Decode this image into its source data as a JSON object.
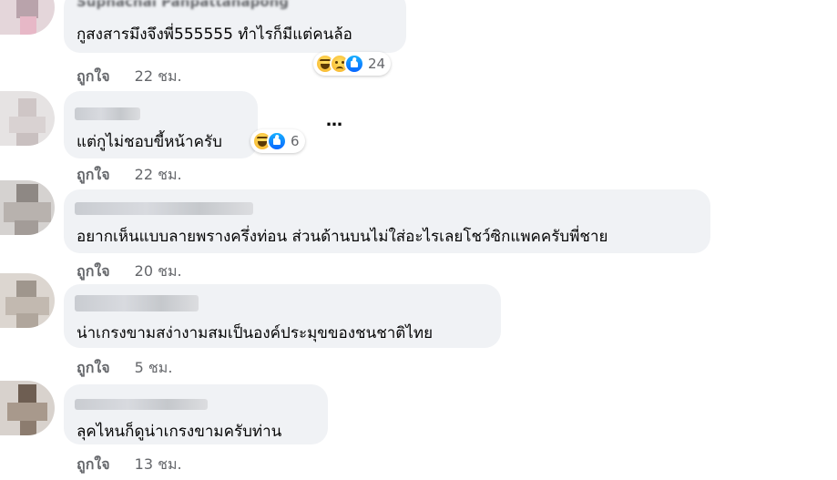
{
  "comments": [
    {
      "author": "Suphachai Panpattanapong",
      "text": "กูสงสารมึงจึงพี่555555 ทำไรก็มีแต่คนล้อ",
      "like_label": "ถูกใจ",
      "time": "22 ชม.",
      "reactions": [
        "haha-icon",
        "sad-icon",
        "like-icon"
      ],
      "reaction_count": "24"
    },
    {
      "text": "แต่กูไม่ชอบขี้หน้าครับ",
      "like_label": "ถูกใจ",
      "time": "22 ชม.",
      "reactions": [
        "haha-icon",
        "like-icon"
      ],
      "reaction_count": "6",
      "more_label": "…"
    },
    {
      "text": "อยากเห็นแบบลายพรางครึ่งท่อน ส่วนด้านบนไม่ใส่อะไรเลยโชว์ซิกแพคครับพี่ชาย",
      "like_label": "ถูกใจ",
      "time": "20 ชม."
    },
    {
      "text": "น่าเกรงขามสง่างามสมเป็นองค์ประมุขของชนชาติไทย",
      "like_label": "ถูกใจ",
      "time": "5 ชม."
    },
    {
      "text": "ลุคไหนก็ดูน่าเกรงขามครับท่าน",
      "like_label": "ถูกใจ",
      "time": "13 ชม."
    }
  ],
  "colors": {
    "bubble": "#f0f2f5",
    "secondary_text": "#65676b",
    "like_blue": "#0866ff",
    "haha_yellow": "#f7b125"
  }
}
